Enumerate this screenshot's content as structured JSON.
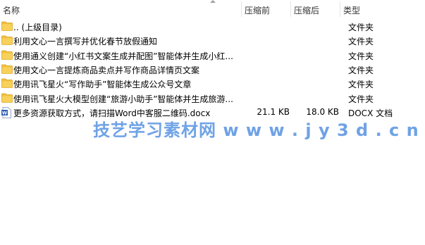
{
  "header": {
    "name": "名称",
    "compressed": "压缩前",
    "uncompressed": "压缩后",
    "type": "类型"
  },
  "rows": [
    {
      "name": ".. (上级目录)",
      "before": "",
      "after": "",
      "type": "文件夹",
      "icon": "folder-icon"
    },
    {
      "name": "利用文心一言撰写并优化春节放假通知",
      "before": "",
      "after": "",
      "type": "文件夹",
      "icon": "folder-icon"
    },
    {
      "name": "使用通义创建“小红书文案生成并配图”智能体并生成小红...",
      "before": "",
      "after": "",
      "type": "文件夹",
      "icon": "folder-icon"
    },
    {
      "name": "使用文心一言提炼商品卖点并写作商品详情页文案",
      "before": "",
      "after": "",
      "type": "文件夹",
      "icon": "folder-icon"
    },
    {
      "name": "使用讯飞星火“写作助手”智能体生成公众号文章",
      "before": "",
      "after": "",
      "type": "文件夹",
      "icon": "folder-icon"
    },
    {
      "name": "使用讯飞星火大模型创建“旅游小助手”智能体并生成旅游...",
      "before": "",
      "after": "",
      "type": "文件夹",
      "icon": "folder-icon"
    },
    {
      "name": "更多资源获取方式，请扫描Word中客服二维码.docx",
      "before": "21.1 KB",
      "after": "18.0 KB",
      "type": "DOCX 文档",
      "icon": "word-doc-icon"
    }
  ],
  "watermark": "技艺学习素材网  w w w . j y 3 d . c n",
  "colors": {
    "folder": "#f5c542",
    "word": "#2b5eb7",
    "watermark": "#6fa2e6"
  }
}
